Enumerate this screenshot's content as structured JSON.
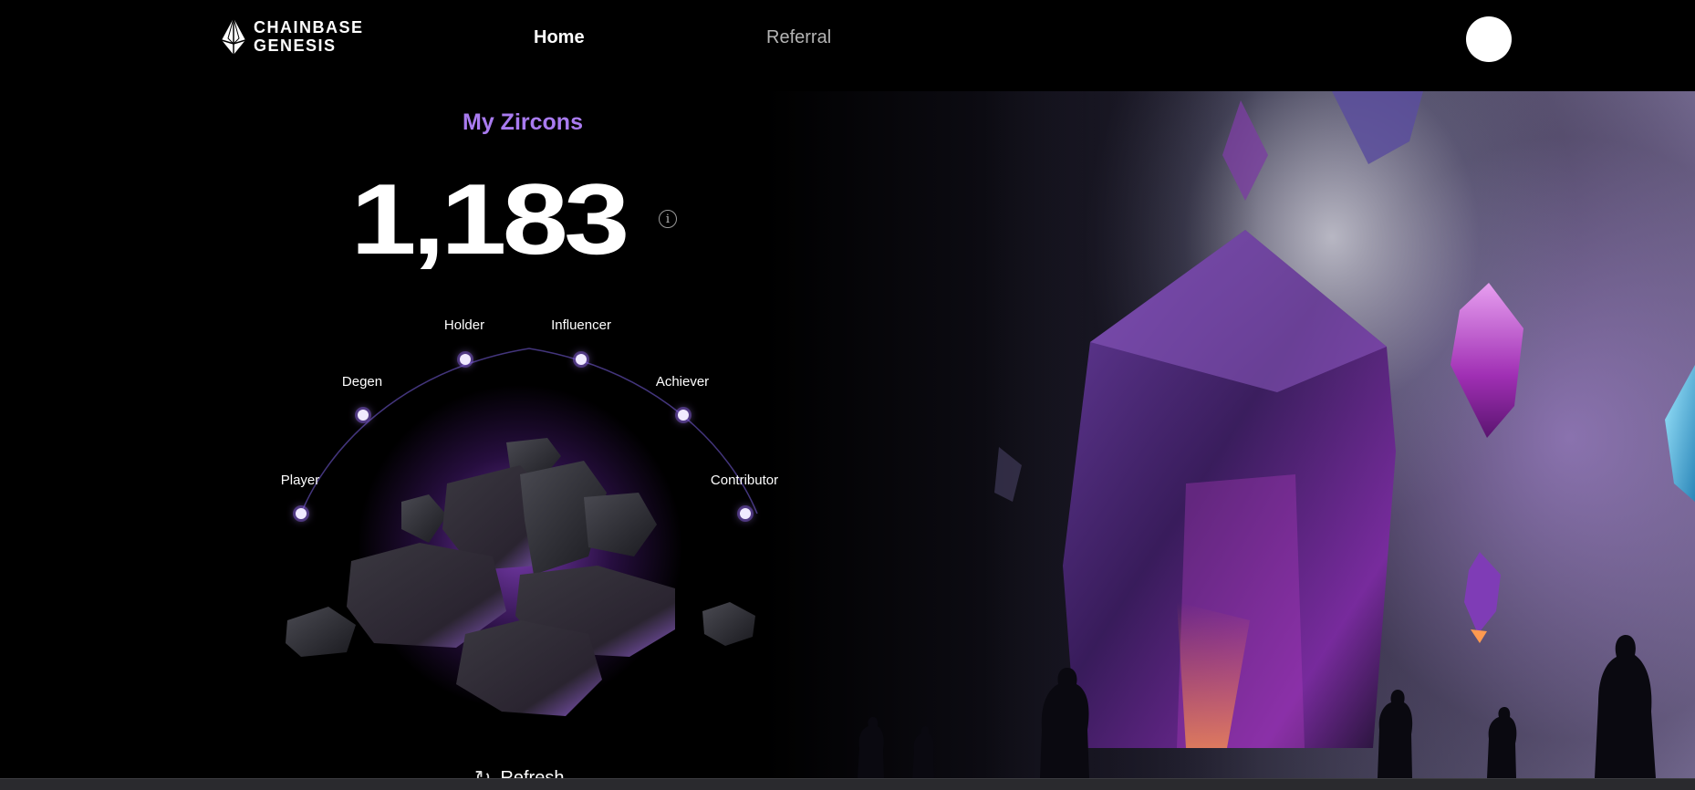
{
  "brand": {
    "line1": "CHAINBASE",
    "line2": "GENESIS",
    "logo": "diamond-crystal-icon"
  },
  "nav": {
    "home": "Home",
    "referral": "Referral"
  },
  "zircons": {
    "title": "My Zircons",
    "value": "1,183",
    "info_icon": "info-icon"
  },
  "tiers": [
    "Player",
    "Degen",
    "Holder",
    "Influencer",
    "Achiever",
    "Contributor"
  ],
  "refresh": {
    "label": "Refresh",
    "icon": "refresh-icon"
  },
  "colors": {
    "accent": "#a97bf0",
    "background": "#000000",
    "glow": "#8a3fd6"
  }
}
